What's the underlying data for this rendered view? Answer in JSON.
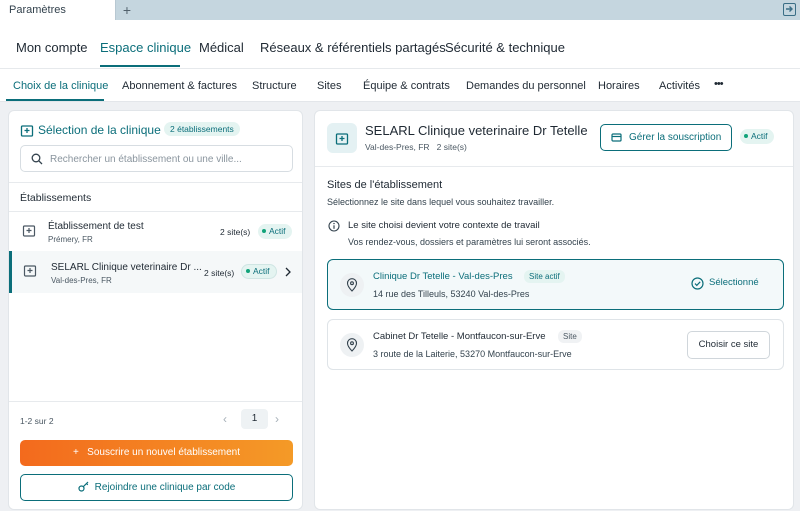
{
  "colors": {
    "accent": "#0b6e7a",
    "active_bg": "#e4f4f1",
    "status_dot": "#11a37a",
    "cta_start": "#f36a1d",
    "cta_end": "#f49a27",
    "tabbar": "#c5d6df"
  },
  "window": {
    "tab_label": "Paramètres",
    "new_tab_label": "+"
  },
  "main_nav": {
    "items": [
      {
        "label": "Mon compte"
      },
      {
        "label": "Espace clinique",
        "active": true
      },
      {
        "label": "Médical"
      },
      {
        "label": "Réseaux & référentiels partagés"
      },
      {
        "label": "Sécurité & technique"
      }
    ]
  },
  "sub_nav": {
    "items": [
      {
        "label": "Choix de la clinique",
        "active": true
      },
      {
        "label": "Abonnement & factures"
      },
      {
        "label": "Structure"
      },
      {
        "label": "Sites"
      },
      {
        "label": "Équipe & contrats"
      },
      {
        "label": "Demandes du personnel"
      },
      {
        "label": "Horaires"
      },
      {
        "label": "Activités"
      }
    ],
    "more_label": "•••"
  },
  "left_panel": {
    "title": "Sélection de la clinique",
    "count_badge": "2 établissements",
    "search_placeholder": "Rechercher un établissement ou une ville...",
    "section_label": "Établissements",
    "establishments": [
      {
        "name": "Établissement de test",
        "location": "Prémery, FR",
        "sites": "2 site(s)",
        "status": "Actif",
        "selected": false
      },
      {
        "name": "SELARL Clinique veterinaire Dr ...",
        "location": "Val-des-Pres, FR",
        "sites": "2 site(s)",
        "status": "Actif",
        "selected": true
      }
    ],
    "pagination": {
      "range_text": "1-2 sur 2",
      "current_page": "1",
      "prev_icon": "chevron-left-icon",
      "next_icon": "chevron-right-icon"
    },
    "subscribe_button": "Souscrire un nouvel établissement",
    "join_button": "Rejoindre une clinique par code"
  },
  "right_panel": {
    "title": "SELARL Clinique veterinaire Dr Tetelle",
    "subtitle": "Val-des-Pres, FR",
    "sites_count": "2 site(s)",
    "manage_button": "Gérer la souscription",
    "status": "Actif",
    "sites_section": {
      "title": "Sites de l'établissement",
      "description": "Sélectionnez le site dans lequel vous souhaitez travailler.",
      "info_title": "Le site choisi devient votre contexte de travail",
      "info_description": "Vos rendez-vous, dossiers et paramètres lui seront associés."
    },
    "sites": [
      {
        "name": "Clinique Dr Tetelle - Val-des-Pres",
        "tag": "Site actif",
        "address": "14 rue des Tilleuls, 53240 Val-des-Pres",
        "selected_label": "Sélectionné"
      },
      {
        "name": "Cabinet Dr Tetelle - Montfaucon-sur-Erve",
        "tag": "Site",
        "address": "3 route de la Laiterie, 53270 Montfaucon-sur-Erve",
        "action_label": "Choisir ce site"
      }
    ]
  }
}
